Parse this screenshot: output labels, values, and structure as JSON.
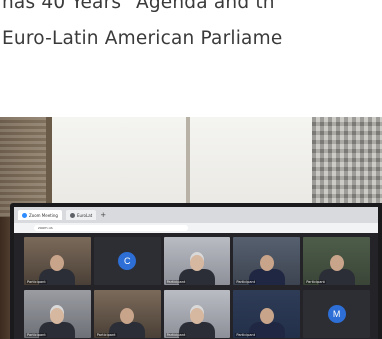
{
  "article": {
    "line_1": "has 40 Years\" Agenda and th",
    "line_2": "Euro-Latin American Parliame"
  },
  "photo": {
    "browser": {
      "tabs": [
        {
          "label": "Zoom Meeting"
        },
        {
          "label": "EuroLat"
        }
      ],
      "new_tab_symbol": "+",
      "url": "zoom.us"
    },
    "participants": [
      {
        "name": "Participant",
        "initial": ""
      },
      {
        "name": "",
        "initial": "C"
      },
      {
        "name": "Participant",
        "initial": ""
      },
      {
        "name": "Participant",
        "initial": ""
      },
      {
        "name": "Participant",
        "initial": ""
      },
      {
        "name": "Participant",
        "initial": ""
      },
      {
        "name": "Participant",
        "initial": ""
      },
      {
        "name": "Participant",
        "initial": ""
      },
      {
        "name": "Participant",
        "initial": ""
      },
      {
        "name": "",
        "initial": "M"
      }
    ]
  }
}
